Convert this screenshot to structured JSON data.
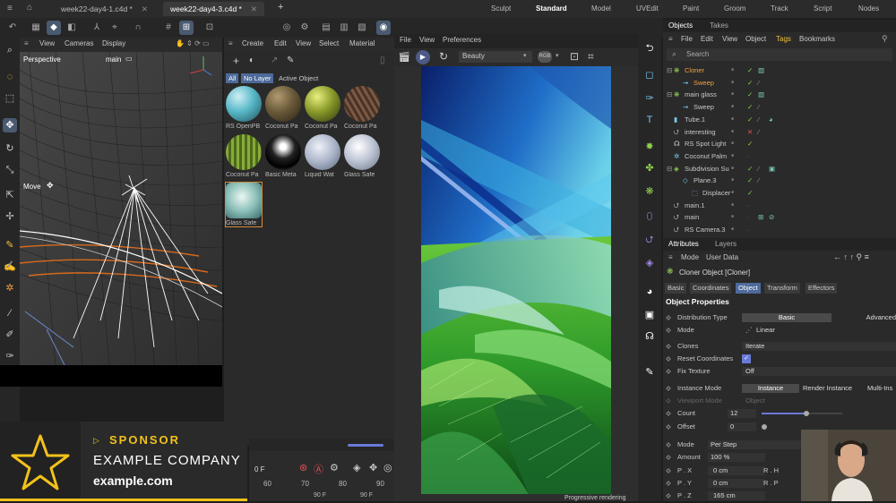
{
  "tabs": [
    {
      "label": "week22-day4-1.c4d *",
      "active": false
    },
    {
      "label": "week22-day4-3.c4d *",
      "active": true
    }
  ],
  "layouts": [
    "Sculpt",
    "Standard",
    "Model",
    "UVEdit",
    "Paint",
    "Groom",
    "Track",
    "Script",
    "Nodes"
  ],
  "active_layout": "Standard",
  "viewport": {
    "menu": [
      "View",
      "Cameras",
      "Display"
    ],
    "label": "Perspective",
    "camera": "main",
    "tool_label": "Move"
  },
  "materials": {
    "menu": [
      "Create",
      "Edit",
      "View",
      "Select",
      "Material"
    ],
    "filters": [
      "All",
      "No Layer",
      "Active Object"
    ],
    "items": [
      {
        "label": "RS OpenPB",
        "color": "#58b8c8"
      },
      {
        "label": "Coconut Pa",
        "color": "#6b5a3a"
      },
      {
        "label": "Coconut Pa",
        "color": "#8a9a2a"
      },
      {
        "label": "Coconut Pa",
        "color": "#6b4a3a"
      },
      {
        "label": "Coconut Pa",
        "color": "#7a9a3a"
      },
      {
        "label": "Basic Meta",
        "color": "#111111"
      },
      {
        "label": "Liquid Wat",
        "color": "#aab4c8"
      },
      {
        "label": "Glass Safe",
        "color": "#b8c0d0"
      },
      {
        "label": "Glass Safe",
        "color": "#8cc0b8"
      }
    ]
  },
  "timeline": {
    "frame": "0 F",
    "ticks": [
      "60",
      "70",
      "80",
      "90"
    ],
    "end1": "90 F",
    "end2": "90 F"
  },
  "render_view": {
    "menu": [
      "File",
      "View",
      "Preferences"
    ],
    "preset": "Beauty",
    "status": "Progressive rendering"
  },
  "objects": {
    "tabs": [
      "Objects",
      "Takes"
    ],
    "menu": [
      "File",
      "Edit",
      "View",
      "Object",
      "Tags",
      "Bookmarks"
    ],
    "search_placeholder": "Search",
    "rows": [
      {
        "name": "Cloner",
        "indent": 0,
        "color": "#f0a040"
      },
      {
        "name": "Sweep",
        "indent": 1,
        "color": "#f0a040"
      },
      {
        "name": "main glass",
        "indent": 0,
        "color": "#c8c8c8"
      },
      {
        "name": "Sweep",
        "indent": 1,
        "color": "#c8c8c8"
      },
      {
        "name": "Tube.1",
        "indent": 0,
        "color": "#c8c8c8"
      },
      {
        "name": "interesting",
        "indent": 0,
        "color": "#c8c8c8"
      },
      {
        "name": "RS Spot Light",
        "indent": 0,
        "color": "#c8c8c8"
      },
      {
        "name": "Coconut Palm",
        "indent": 0,
        "color": "#c8c8c8"
      },
      {
        "name": "Subdivision Su",
        "indent": 0,
        "color": "#c8c8c8"
      },
      {
        "name": "Plane.3",
        "indent": 1,
        "color": "#c8c8c8"
      },
      {
        "name": "Displacer",
        "indent": 2,
        "color": "#c8c8c8"
      },
      {
        "name": "main.1",
        "indent": 0,
        "color": "#c8c8c8"
      },
      {
        "name": "main",
        "indent": 0,
        "color": "#c8c8c8"
      },
      {
        "name": "RS Camera.3",
        "indent": 0,
        "color": "#c8c8c8"
      }
    ]
  },
  "attributes": {
    "tabs": [
      "Attributes",
      "Layers"
    ],
    "mode_menu": [
      "Mode",
      "User Data"
    ],
    "object_title": "Cloner Object [Cloner]",
    "subtabs": [
      "Basic",
      "Coordinates",
      "Object",
      "Transform",
      "Effectors"
    ],
    "active_subtab": "Object",
    "section": "Object Properties",
    "distribution_label": "Distribution Type",
    "distribution_basic": "Basic",
    "distribution_advanced": "Advanced",
    "mode_label": "Mode",
    "mode_value": "Linear",
    "clones_label": "Clones",
    "clones_value": "Iterate",
    "reset_label": "Reset Coordinates",
    "fix_label": "Fix Texture",
    "fix_value": "Off",
    "instance_label": "Instance Mode",
    "instance_opts": [
      "Instance",
      "Render Instance",
      "Multi-Ins"
    ],
    "viewport_mode_label": "Viewport Mode",
    "viewport_mode_value": "Object",
    "count_label": "Count",
    "count_value": "12",
    "count_level": 0.55,
    "offset_label": "Offset",
    "offset_value": "0",
    "mode2_label": "Mode",
    "mode2_value": "Per Step",
    "amount_label": "Amount",
    "amount_value": "100 %",
    "px_label": "P . X",
    "px_value": "0 cm",
    "py_label": "P . Y",
    "py_value": "0 cm",
    "pz_label": "P . Z",
    "pz_value": "165 cm",
    "rh_label": "R . H",
    "rp_label": "R . P"
  },
  "sponsor": {
    "label": "SPONSOR",
    "company": "EXAMPLE COMPANY",
    "url": "example.com"
  },
  "colors": {
    "accent": "#4d6a9a",
    "sponsor_gold": "#f2c21b",
    "check": "#8fd14f"
  }
}
